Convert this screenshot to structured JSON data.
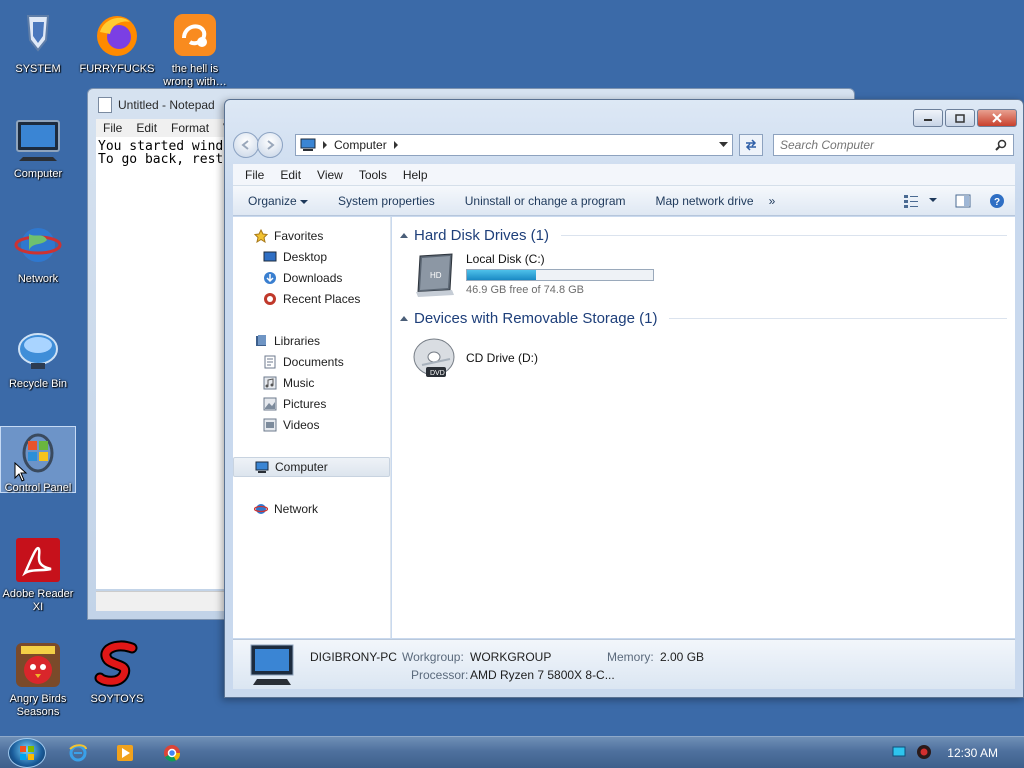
{
  "desktop": {
    "icons": [
      {
        "label": "SYSTEM"
      },
      {
        "label": "FURRYFUCKS"
      },
      {
        "label": "the hell is wrong with…"
      },
      {
        "label": "Computer"
      },
      {
        "label": "Network"
      },
      {
        "label": "Recycle Bin"
      },
      {
        "label": "Control Panel"
      },
      {
        "label": "Adobe Reader XI"
      },
      {
        "label": "Angry Birds Seasons"
      },
      {
        "label": "SOYTOYS"
      }
    ]
  },
  "notepad": {
    "title": "Untitled - Notepad",
    "menu": [
      "File",
      "Edit",
      "Format",
      "V"
    ],
    "text_line1": "You started wind",
    "text_line2": "To go back, rest"
  },
  "explorer": {
    "address": {
      "location": "Computer"
    },
    "search": {
      "placeholder": "Search Computer"
    },
    "menu": [
      "File",
      "Edit",
      "View",
      "Tools",
      "Help"
    ],
    "commands": {
      "organize": "Organize",
      "system_properties": "System properties",
      "uninstall": "Uninstall or change a program",
      "map_drive": "Map network drive",
      "more": "»"
    },
    "nav": {
      "favorites": "Favorites",
      "desktop": "Desktop",
      "downloads": "Downloads",
      "recent": "Recent Places",
      "libraries": "Libraries",
      "documents": "Documents",
      "music": "Music",
      "pictures": "Pictures",
      "videos": "Videos",
      "computer": "Computer",
      "network": "Network"
    },
    "groups": {
      "hdd_title": "Hard Disk Drives (1)",
      "removable_title": "Devices with Removable Storage (1)"
    },
    "drives": {
      "local_name": "Local Disk (C:)",
      "local_free": "46.9 GB free of 74.8 GB",
      "local_used_fraction": 0.373,
      "cd_name": "CD Drive (D:)"
    },
    "details": {
      "pc_name": "DIGIBRONY-PC",
      "workgroup_label": "Workgroup:",
      "workgroup": "WORKGROUP",
      "memory_label": "Memory:",
      "memory": "2.00 GB",
      "processor_label": "Processor:",
      "processor": "AMD Ryzen 7 5800X 8-C..."
    }
  },
  "taskbar": {
    "clock": "12:30 AM"
  },
  "colors": {
    "desktop_bg": "#3b6aa8",
    "progress_fill": "#26a0da"
  }
}
